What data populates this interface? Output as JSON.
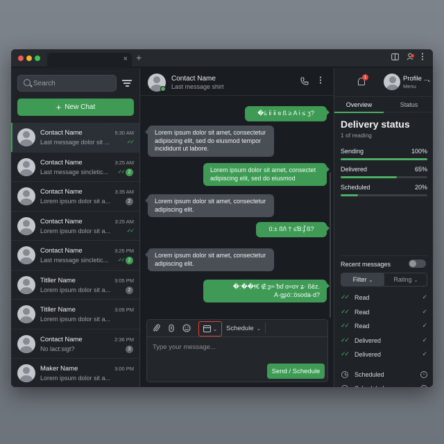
{
  "titlebar": {
    "tab_close_glyph": "×",
    "new_tab_glyph": "+",
    "dot_colors": [
      "#ee5b54",
      "#f2b233",
      "#3fc24b"
    ]
  },
  "sidebar": {
    "search_placeholder": "Search",
    "new_chat_label": "New Chat",
    "contacts": [
      {
        "name": "Contact Name",
        "last": "Last message dolor sit ...",
        "time": "5:30 AM",
        "ticks": "✓✓",
        "badge": ""
      },
      {
        "name": "Contact Name",
        "last": "Last message sincletic...",
        "time": "3:25 AM",
        "ticks": "✓✓",
        "badge": "2"
      },
      {
        "name": "Contact Name",
        "last": "Lorem ipsum dolor sit a...",
        "time": "3:35 AM",
        "ticks": "",
        "badge": "2"
      },
      {
        "name": "Contact Name",
        "last": "Lorem ipsum dolor sit a...",
        "time": "3:25 AM",
        "ticks": "✓✓",
        "badge": ""
      },
      {
        "name": "Contact Name",
        "last": "Last message sincletic...",
        "time": "3:25 PM",
        "ticks": "✓✓",
        "badge": "2"
      },
      {
        "name": "Titller Name",
        "last": "Lorem ipsum dolor sit a...",
        "time": "3:05 PM",
        "ticks": "",
        "badge": "2"
      },
      {
        "name": "Titller Name",
        "last": "Lorem ipsum dolor sit a...",
        "time": "3:09 PM",
        "ticks": "",
        "badge": ""
      },
      {
        "name": "Contact Name",
        "last": "No lact:sigt?",
        "time": "2:36 PM",
        "ticks": "",
        "badge": "3"
      },
      {
        "name": "Maker Name",
        "last": "Lorem ipsum dolor sit a...",
        "time": "3:00 PM",
        "ticks": "",
        "badge": ""
      }
    ]
  },
  "chat": {
    "contact_name": "Contact Name",
    "contact_sub": "Last message shirt",
    "messages": [
      {
        "dir": "out",
        "text": "�ﾑ ⅱ ⅱ ɞ ß ≥ A ⅰ ≤ ʒ?"
      },
      {
        "dir": "in",
        "text": "Lorem ipsum dolor sit amet, consectetur adipiscing elit, sed do eiusmod tempor incididunt ut labore."
      },
      {
        "dir": "out",
        "text": "Lorem ipsum dolor sit amet, consectet adipiscing elit, sed do eiusmod"
      },
      {
        "dir": "in",
        "text": "Lorem ipsum dolor sit amet, consectetur adipiscing elit."
      },
      {
        "dir": "out",
        "text": "ῦ:± ßñ † ≤Ɓ:ʄ̃ ß?"
      },
      {
        "dir": "in",
        "text": "Lorem ipsum dolor sit amet, consectetur adipiscing elit."
      },
      {
        "dir": "out",
        "text": "�:��ɬ€ ∉:ʂ≈ ᵬɗ ɑ≈ɑʏ ʑ· ßëz. A·gʂó::ösoda·d?"
      }
    ],
    "composer": {
      "schedule_label": "Schedule",
      "placeholder": "Type your message...",
      "send_label": "Send / Schedule"
    }
  },
  "panel": {
    "notif_count": "1",
    "profile_name": "Profile ...",
    "profile_menu": "Menu",
    "tabs": [
      "Overview",
      "Status"
    ],
    "title": "Delivery status",
    "subtitle": "1 of reading",
    "metrics": [
      {
        "label": "Sending",
        "value": "100%",
        "fraction": 1.0
      },
      {
        "label": "Delivered",
        "value": "65%",
        "fraction": 0.65
      },
      {
        "label": "Scheduled",
        "value": "20%",
        "fraction": 0.2
      }
    ],
    "recent_label": "Recent messages",
    "filter_label": "Filter",
    "rating_label": "Rating",
    "recent": [
      {
        "label": "Read",
        "kind": "check"
      },
      {
        "label": "Read",
        "kind": "check"
      },
      {
        "label": "Read",
        "kind": "check"
      },
      {
        "label": "Delivered",
        "kind": "check"
      },
      {
        "label": "Delivered",
        "kind": "check"
      },
      {
        "label": "Scheduled",
        "kind": "clock"
      },
      {
        "label": "Scheduled",
        "kind": "clock"
      }
    ]
  },
  "colors": {
    "accent": "#3f9a55",
    "alert": "#e0443c",
    "outline": "#d8433b"
  }
}
